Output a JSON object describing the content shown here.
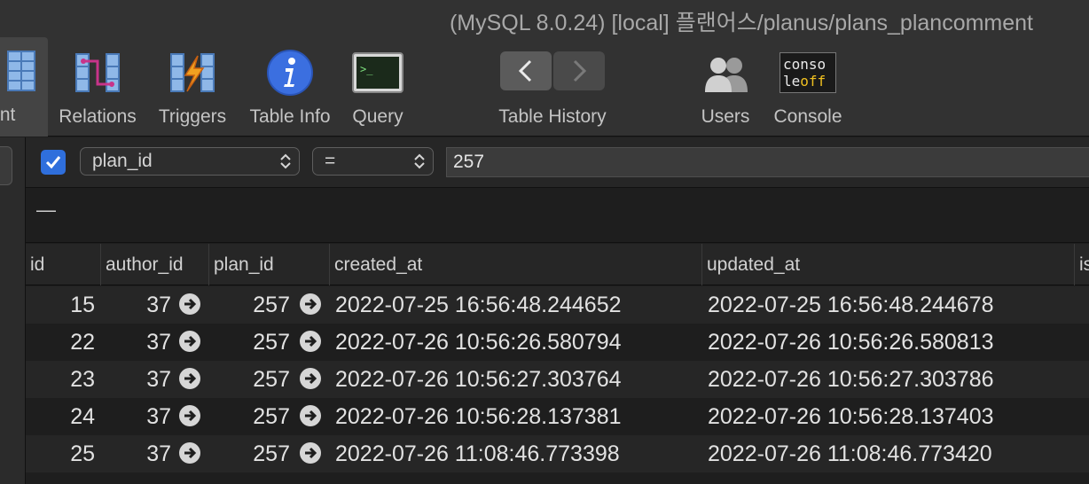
{
  "window": {
    "title": "(MySQL 8.0.24) [local] 플랜어스/planus/plans_plancomment"
  },
  "toolbar": {
    "content_label": "ntent",
    "relations_label": "Relations",
    "triggers_label": "Triggers",
    "table_info_label": "Table Info",
    "query_label": "Query",
    "table_history_label": "Table History",
    "users_label": "Users",
    "console_label": "Console",
    "console_icon_text_top": "conso",
    "console_icon_text_bottom_a": "le",
    "console_icon_text_bottom_b": "off"
  },
  "filter": {
    "enabled": true,
    "field": "plan_id",
    "operator": "=",
    "value": "257"
  },
  "subbar": {
    "dash": "—"
  },
  "table": {
    "columns": [
      "id",
      "author_id",
      "plan_id",
      "created_at",
      "updated_at",
      "is"
    ],
    "rows": [
      {
        "id": "15",
        "author_id": "37",
        "plan_id": "257",
        "created_at": "2022-07-25 16:56:48.244652",
        "updated_at": "2022-07-25 16:56:48.244678"
      },
      {
        "id": "22",
        "author_id": "37",
        "plan_id": "257",
        "created_at": "2022-07-26 10:56:26.580794",
        "updated_at": "2022-07-26 10:56:26.580813"
      },
      {
        "id": "23",
        "author_id": "37",
        "plan_id": "257",
        "created_at": "2022-07-26 10:56:27.303764",
        "updated_at": "2022-07-26 10:56:27.303786"
      },
      {
        "id": "24",
        "author_id": "37",
        "plan_id": "257",
        "created_at": "2022-07-26 10:56:28.137381",
        "updated_at": "2022-07-26 10:56:28.137403"
      },
      {
        "id": "25",
        "author_id": "37",
        "plan_id": "257",
        "created_at": "2022-07-26 11:08:46.773398",
        "updated_at": "2022-07-26 11:08:46.773420"
      }
    ]
  },
  "colors": {
    "accent": "#2f6fdc",
    "table_info_icon": "#3b6fe0"
  }
}
